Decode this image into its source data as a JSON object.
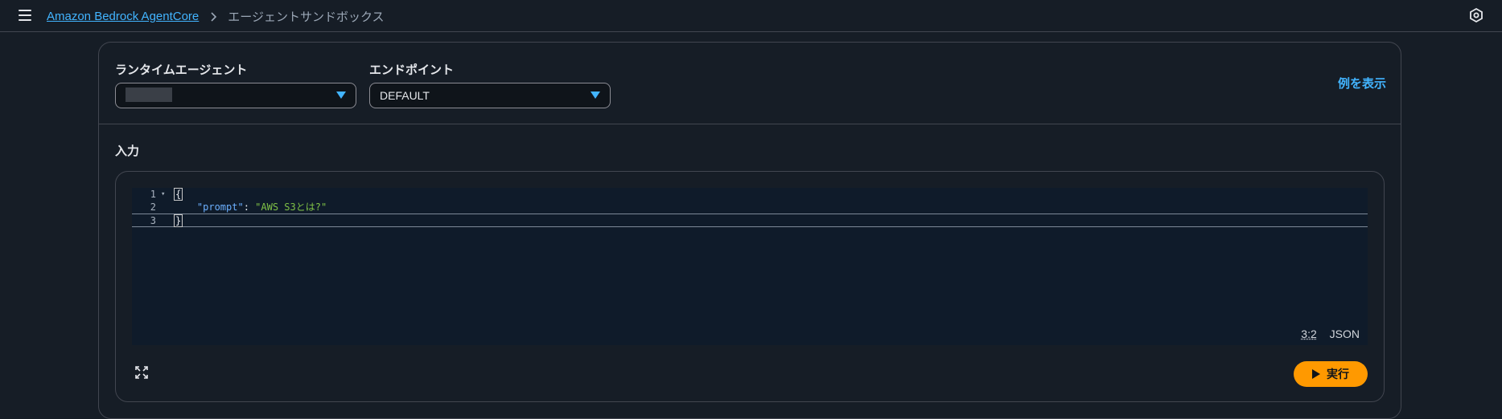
{
  "breadcrumb": {
    "root": "Amazon Bedrock AgentCore",
    "current": "エージェントサンドボックス"
  },
  "config": {
    "runtime_agent_label": "ランタイムエージェント",
    "runtime_agent_value": "",
    "endpoint_label": "エンドポイント",
    "endpoint_value": "DEFAULT",
    "show_example": "例を表示"
  },
  "input": {
    "section_title": "入力",
    "lines": [
      {
        "num": "1",
        "open": "{"
      },
      {
        "num": "2",
        "key": "\"prompt\"",
        "colon": ": ",
        "value": "\"AWS S3とは?\""
      },
      {
        "num": "3",
        "close": "}"
      }
    ],
    "cursor_position": "3:2",
    "language": "JSON",
    "run_label": "実行"
  },
  "colors": {
    "accent": "#42b4ff",
    "primary_button": "#ff9900",
    "json_key": "#6cb0ff",
    "json_string": "#7fc146"
  },
  "icons": [
    "menu-icon",
    "chevron-right-icon",
    "settings-icon",
    "caret-down-icon",
    "expand-icon",
    "play-icon"
  ]
}
